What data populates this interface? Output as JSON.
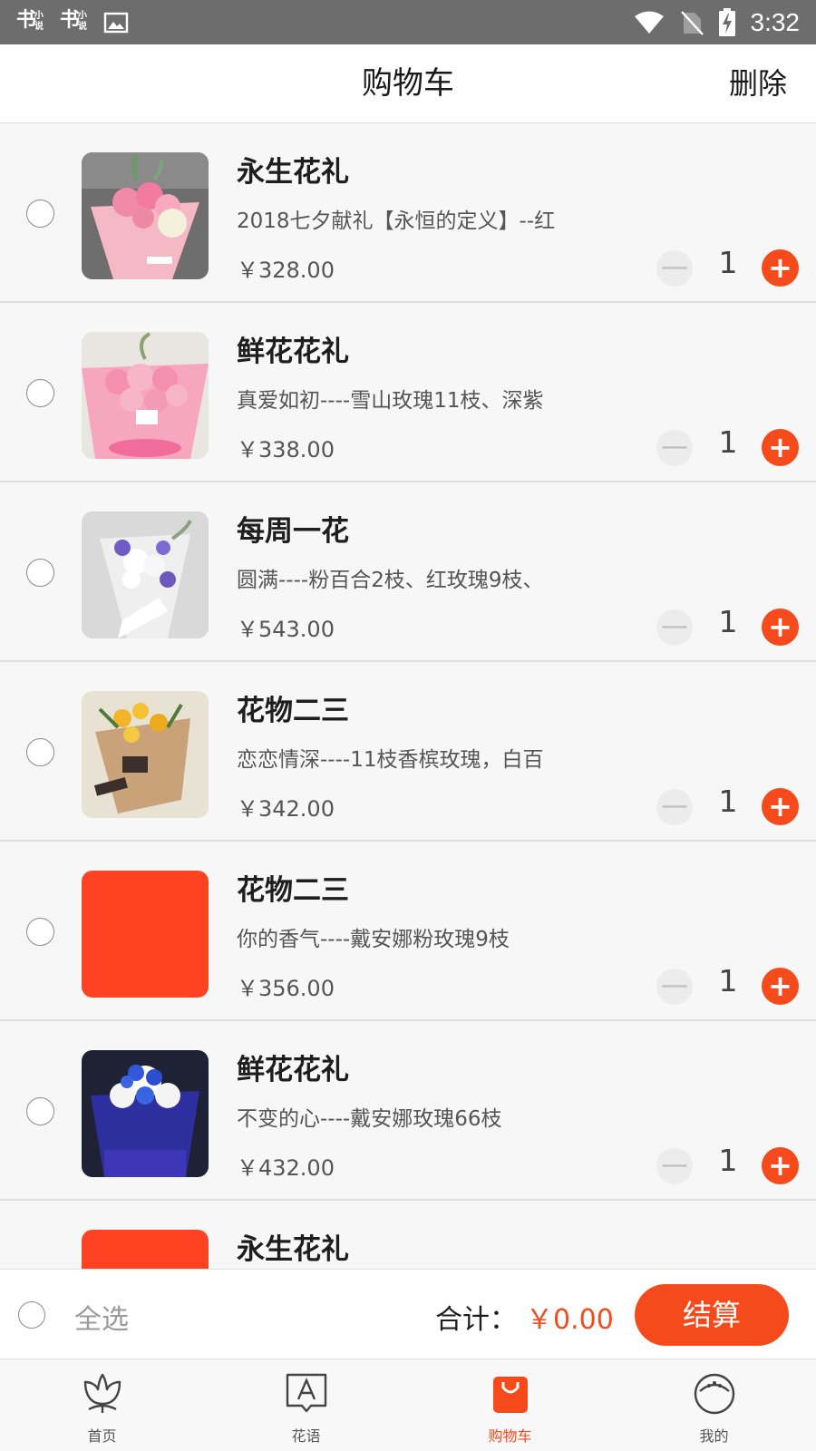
{
  "status_bar": {
    "app_icon_char": "书",
    "app_icon_small_1": "小",
    "app_icon_small_2": "说",
    "time": "3:32"
  },
  "header": {
    "title": "购物车",
    "delete_label": "删除"
  },
  "cart": {
    "items": [
      {
        "title": "永生花礼",
        "desc": "2018七夕献礼【永恒的定义】--红",
        "price": "￥328.00",
        "qty": "1",
        "image": "pink-bouquet"
      },
      {
        "title": "鲜花花礼",
        "desc": "真爱如初----雪山玫瑰11枝、深紫",
        "price": "￥338.00",
        "qty": "1",
        "image": "pink-rose-bouquet"
      },
      {
        "title": "每周一花",
        "desc": "圆满----粉百合2枝、红玫瑰9枝、",
        "price": "￥543.00",
        "qty": "1",
        "image": "white-purple-bouquet"
      },
      {
        "title": "花物二三",
        "desc": "恋恋情深----11枝香槟玫瑰，白百",
        "price": "￥342.00",
        "qty": "1",
        "image": "yellow-bouquet"
      },
      {
        "title": "花物二三",
        "desc": "你的香气----戴安娜粉玫瑰9枝",
        "price": "￥356.00",
        "qty": "1",
        "image": "placeholder"
      },
      {
        "title": "鲜花花礼",
        "desc": "不变的心----戴安娜玫瑰66枝",
        "price": "￥432.00",
        "qty": "1",
        "image": "blue-white-bouquet"
      },
      {
        "title": "永生花礼",
        "desc": "",
        "price": "",
        "qty": "",
        "image": "placeholder"
      }
    ],
    "minus_symbol": "—",
    "plus_symbol": "+"
  },
  "action_bar": {
    "select_all_label": "全选",
    "total_label": "合计：",
    "total_value": "￥0.00",
    "checkout_label": "结算"
  },
  "tab_bar": {
    "tabs": [
      {
        "label": "首页",
        "icon": "tulip-icon",
        "active": false
      },
      {
        "label": "花语",
        "icon": "letter-a-card-icon",
        "active": false
      },
      {
        "label": "购物车",
        "icon": "shopping-bag-icon",
        "active": true
      },
      {
        "label": "我的",
        "icon": "face-icon",
        "active": false
      }
    ]
  },
  "colors": {
    "accent": "#f54a1c",
    "status_bar": "#6d6d6d",
    "placeholder": "#ff4322"
  }
}
